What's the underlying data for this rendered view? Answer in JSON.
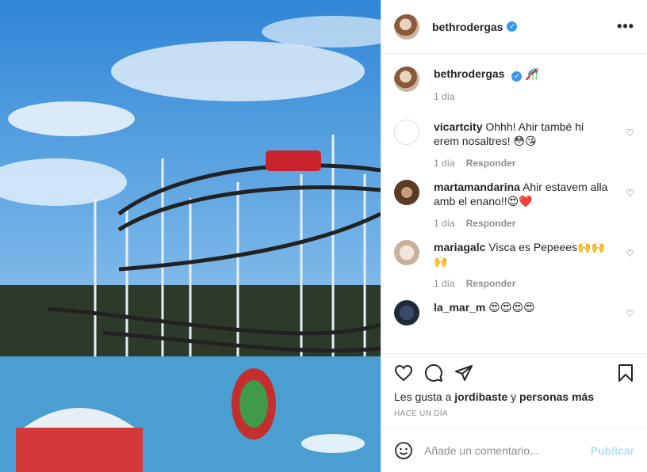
{
  "post": {
    "author": "bethrodergas",
    "more_label": "•••"
  },
  "caption": {
    "username": "bethrodergas",
    "text": "🎢",
    "time": "1 día"
  },
  "comments": [
    {
      "username": "vicartcity",
      "text": "Ohhh! Ahir també hi erem nosaltres! 😳😘",
      "time": "1 día",
      "reply": "Responder"
    },
    {
      "username": "martamandarina",
      "text": "Ahir estavem alla amb el enano!!😍❤️",
      "time": "1 día",
      "reply": "Responder"
    },
    {
      "username": "mariagalc",
      "text": "Visca es Pepeees🙌🙌🙌",
      "time": "1 día",
      "reply": "Responder"
    },
    {
      "username": "la_mar_m",
      "text": "😍😍😍😍",
      "time": "",
      "reply": ""
    }
  ],
  "likes": {
    "prefix": "Les gusta a",
    "user": "jordibaste",
    "joiner": "y",
    "suffix": "personas más"
  },
  "timestamp": "HACE UN DÍA",
  "add_comment": {
    "placeholder": "Añade un comentario...",
    "publish": "Publicar"
  },
  "icons": {
    "like": "heart-icon",
    "comment": "comment-icon",
    "share": "share-icon",
    "save": "bookmark-icon",
    "emoji": "emoji-icon"
  },
  "colors": {
    "verified": "#3897f0",
    "publish": "#b2dffc"
  }
}
